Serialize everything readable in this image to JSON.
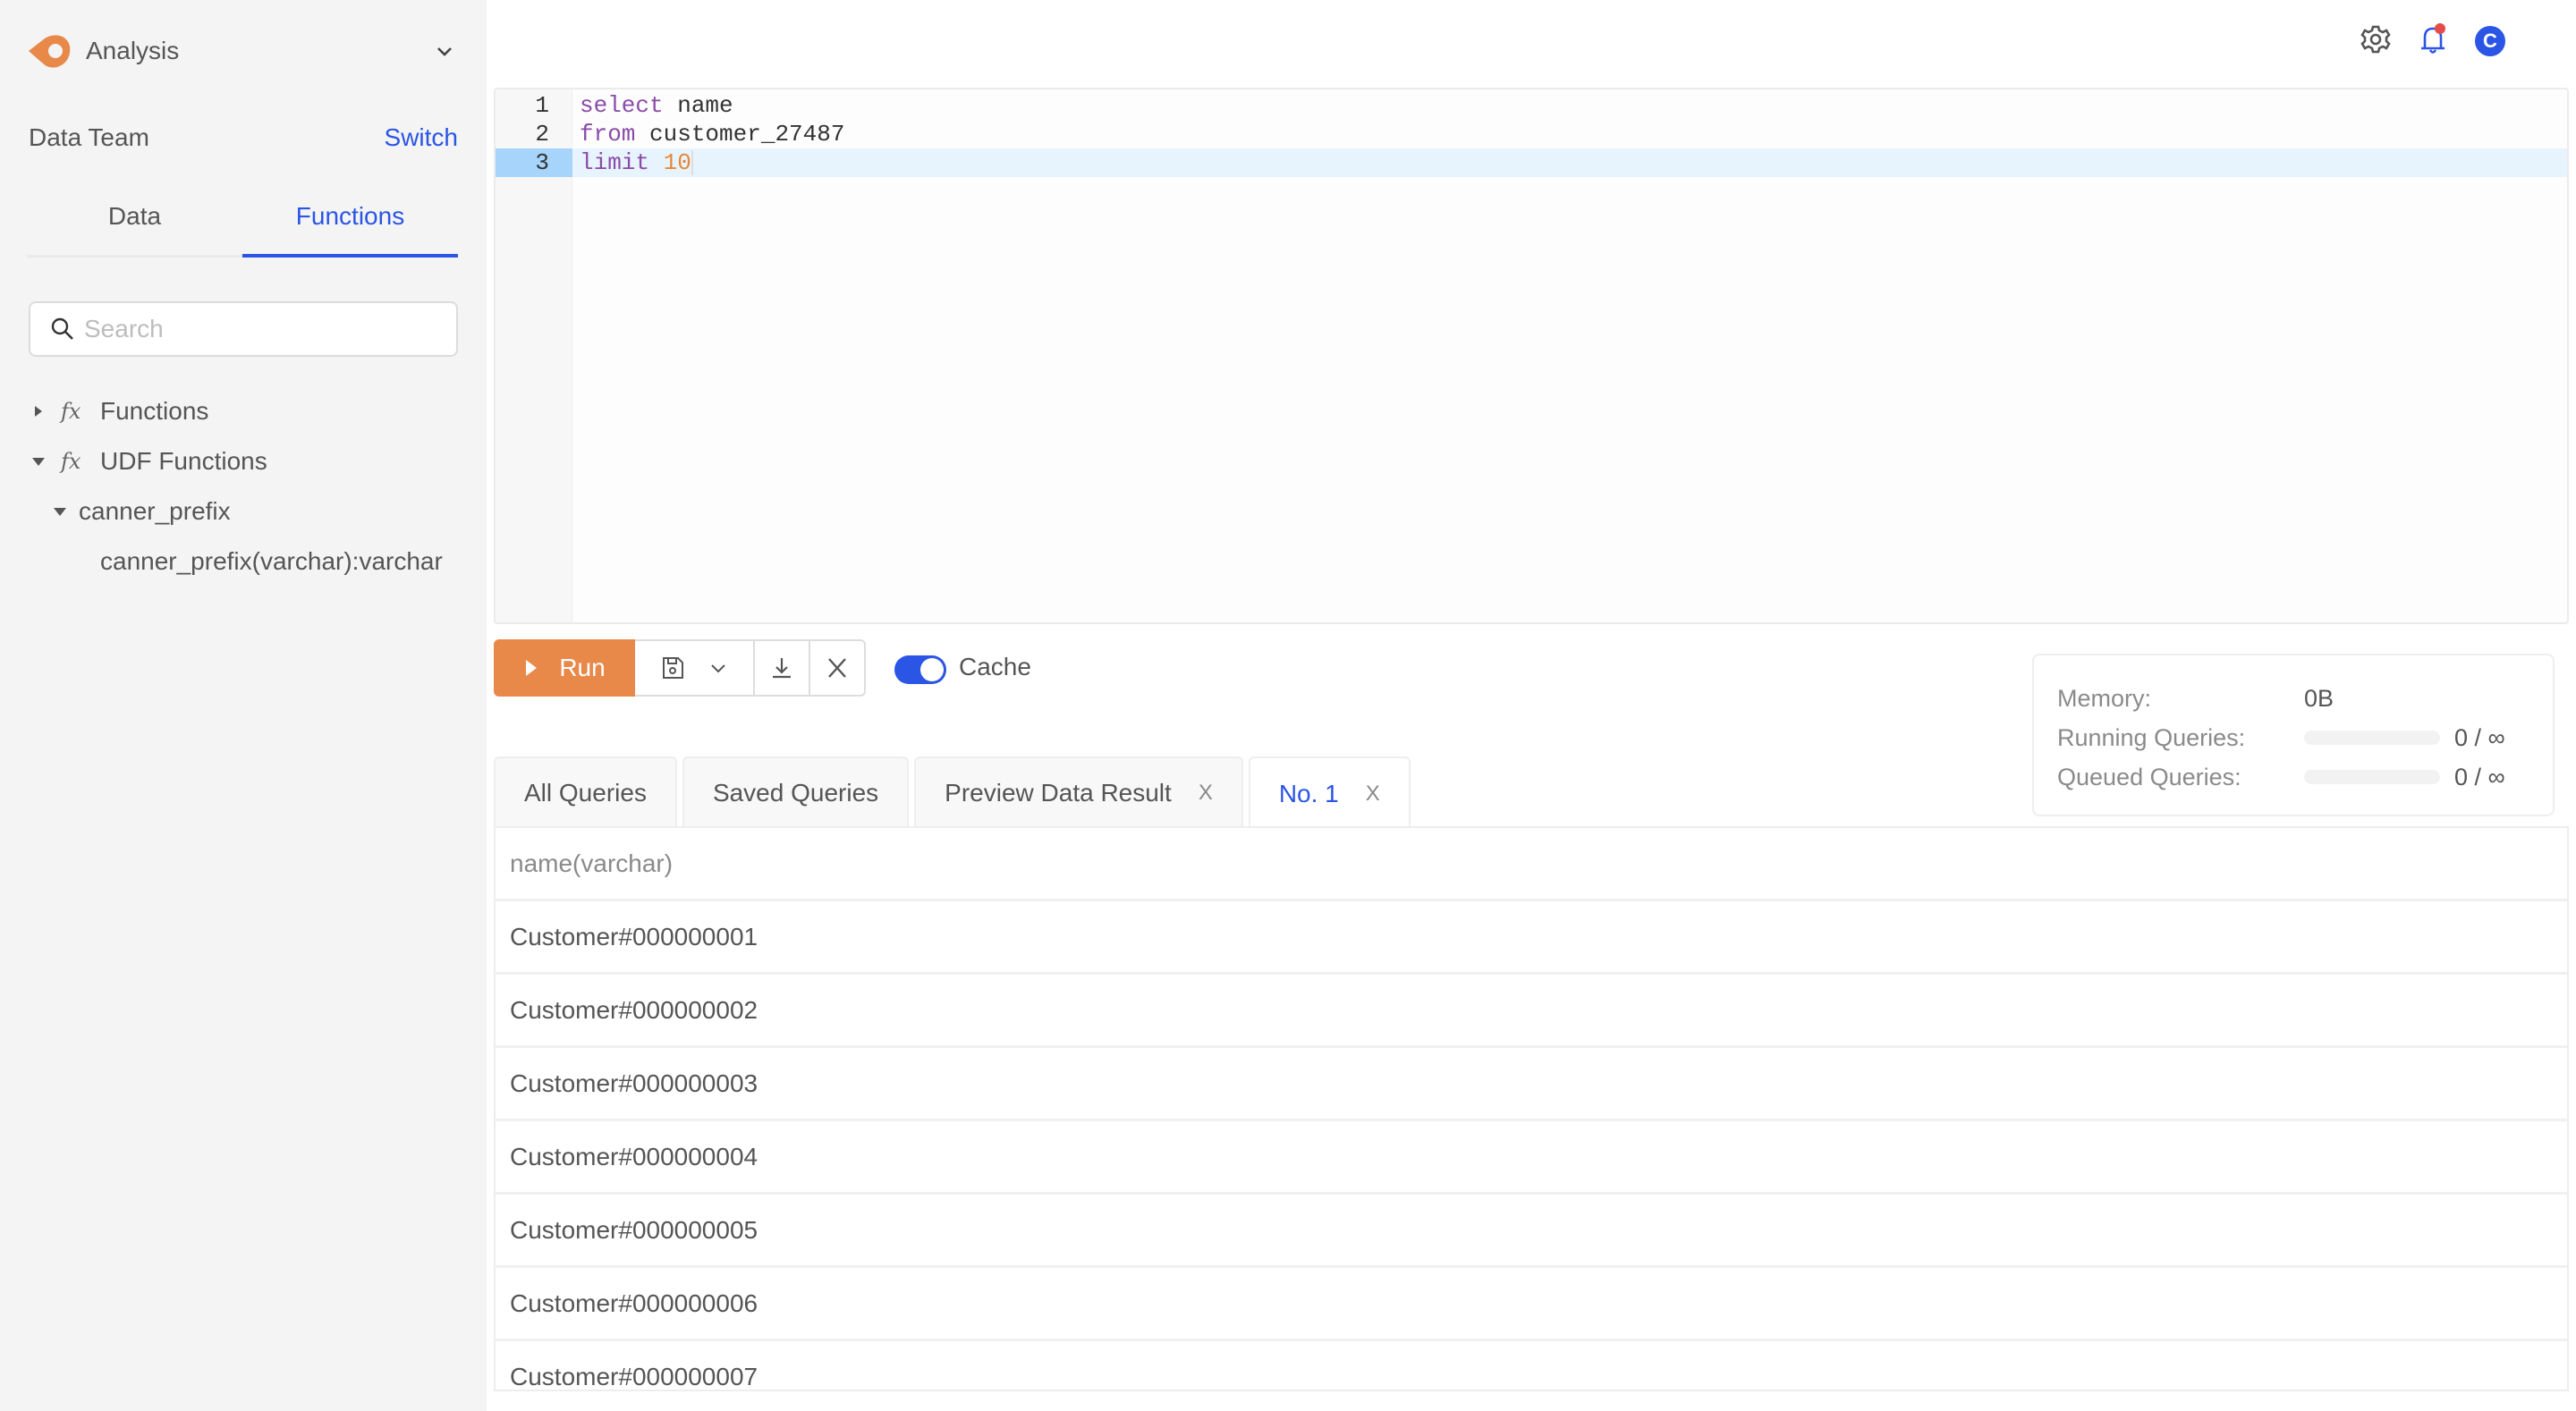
{
  "app": {
    "name": "Analysis",
    "brand_color": "#e8894a"
  },
  "team": {
    "label": "Data Team",
    "switch_label": "Switch"
  },
  "sidebar_tabs": [
    {
      "label": "Data",
      "active": false
    },
    {
      "label": "Functions",
      "active": true
    }
  ],
  "search": {
    "placeholder": "Search",
    "value": ""
  },
  "tree": [
    {
      "label": "Functions",
      "icon": "fx",
      "expanded": false,
      "level": 0
    },
    {
      "label": "UDF Functions",
      "icon": "fx",
      "expanded": true,
      "level": 0
    },
    {
      "label": "canner_prefix",
      "expanded": true,
      "level": 1
    },
    {
      "label": "canner_prefix(varchar):varchar",
      "level": 2
    }
  ],
  "header": {
    "settings_icon": "gear-icon",
    "notifications_icon": "bell-icon",
    "has_notification": true,
    "avatar_initial": "C"
  },
  "editor": {
    "lines": [
      {
        "number": "1",
        "tokens": [
          {
            "t": "select",
            "c": "kw"
          },
          {
            "t": " name",
            "c": ""
          }
        ]
      },
      {
        "number": "2",
        "tokens": [
          {
            "t": "from",
            "c": "kw"
          },
          {
            "t": " customer_27487",
            "c": ""
          }
        ]
      },
      {
        "number": "3",
        "tokens": [
          {
            "t": "limit",
            "c": "kw"
          },
          {
            "t": " ",
            "c": ""
          },
          {
            "t": "10",
            "c": "num"
          }
        ]
      }
    ],
    "active_line": 3
  },
  "toolbar": {
    "run_label": "Run",
    "cache_label": "Cache",
    "cache_enabled": true
  },
  "stats": {
    "memory_label": "Memory:",
    "memory_value": "0B",
    "running_label": "Running Queries:",
    "running_value": "0 / ∞",
    "running_fraction": 0,
    "queued_label": "Queued Queries:",
    "queued_value": "0 / ∞",
    "queued_fraction": 0
  },
  "result_tabs": [
    {
      "label": "All Queries",
      "closable": false,
      "active": false
    },
    {
      "label": "Saved Queries",
      "closable": false,
      "active": false
    },
    {
      "label": "Preview Data Result",
      "closable": true,
      "active": false
    },
    {
      "label": "No. 1",
      "closable": true,
      "active": true
    }
  ],
  "close_glyph": "X",
  "table": {
    "columns": [
      "name(varchar)"
    ],
    "rows": [
      "Customer#000000001",
      "Customer#000000002",
      "Customer#000000003",
      "Customer#000000004",
      "Customer#000000005",
      "Customer#000000006",
      "Customer#000000007"
    ]
  }
}
